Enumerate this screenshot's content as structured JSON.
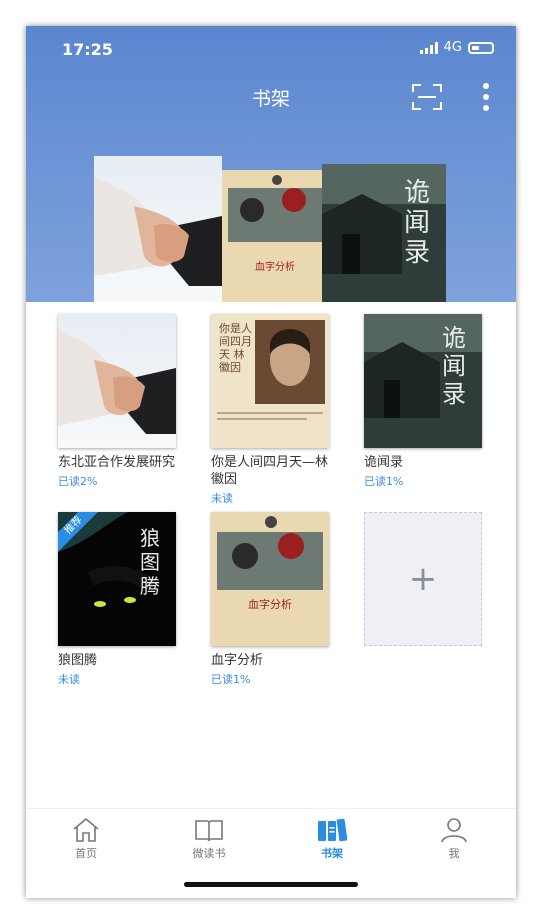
{
  "status_bar": {
    "time": "17:25",
    "network": "4G"
  },
  "header": {
    "title": "书架"
  },
  "books": [
    {
      "title": "东北亚合作发展研究",
      "status": "已读2%"
    },
    {
      "title": "你是人间四月天—林徽因",
      "status": "未读",
      "cover_text": "你是人间四月天 林徽因"
    },
    {
      "title": "诡闻录",
      "status": "已读1%",
      "cover_text": "诡闻录"
    },
    {
      "title": "狼图腾",
      "status": "未读",
      "badge": "推荐",
      "cover_text": "狼图腾"
    },
    {
      "title": "血字分析",
      "status": "已读1%",
      "cover_text": "血字分析"
    }
  ],
  "add_slot": {
    "symbol": "+"
  },
  "tabs": [
    {
      "label": "首页",
      "icon": "home-icon"
    },
    {
      "label": "微读书",
      "icon": "book-icon"
    },
    {
      "label": "书架",
      "icon": "bookshelf-icon",
      "active": true
    },
    {
      "label": "我",
      "icon": "person-icon"
    }
  ],
  "colors": {
    "hero": "#6a92d6",
    "accent": "#2a8de3",
    "status_text": "#3d8be0"
  }
}
